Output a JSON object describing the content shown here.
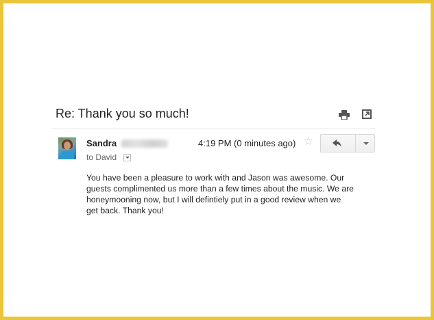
{
  "email": {
    "subject": "Re: Thank you so much!",
    "sender_name": "Sandra",
    "timestamp": "4:19 PM (0 minutes ago)",
    "recipient_line": "to David",
    "body_lines": [
      "You have been a pleasure to work with and Jason was awesome. Our",
      "guests complimented us more than a few times about the music.  We are",
      "honeymooning now, but I will defintiely put in a good review when we",
      "get back. Thank you!"
    ]
  },
  "icons": {
    "print": "print-icon",
    "popout": "new-window-icon",
    "star": "star-icon",
    "reply": "reply-icon",
    "more": "chevron-down-icon"
  },
  "colors": {
    "frame_border": "#e9c53a",
    "text": "#222222",
    "muted_text": "#666666",
    "star": "#c8c8c8"
  }
}
